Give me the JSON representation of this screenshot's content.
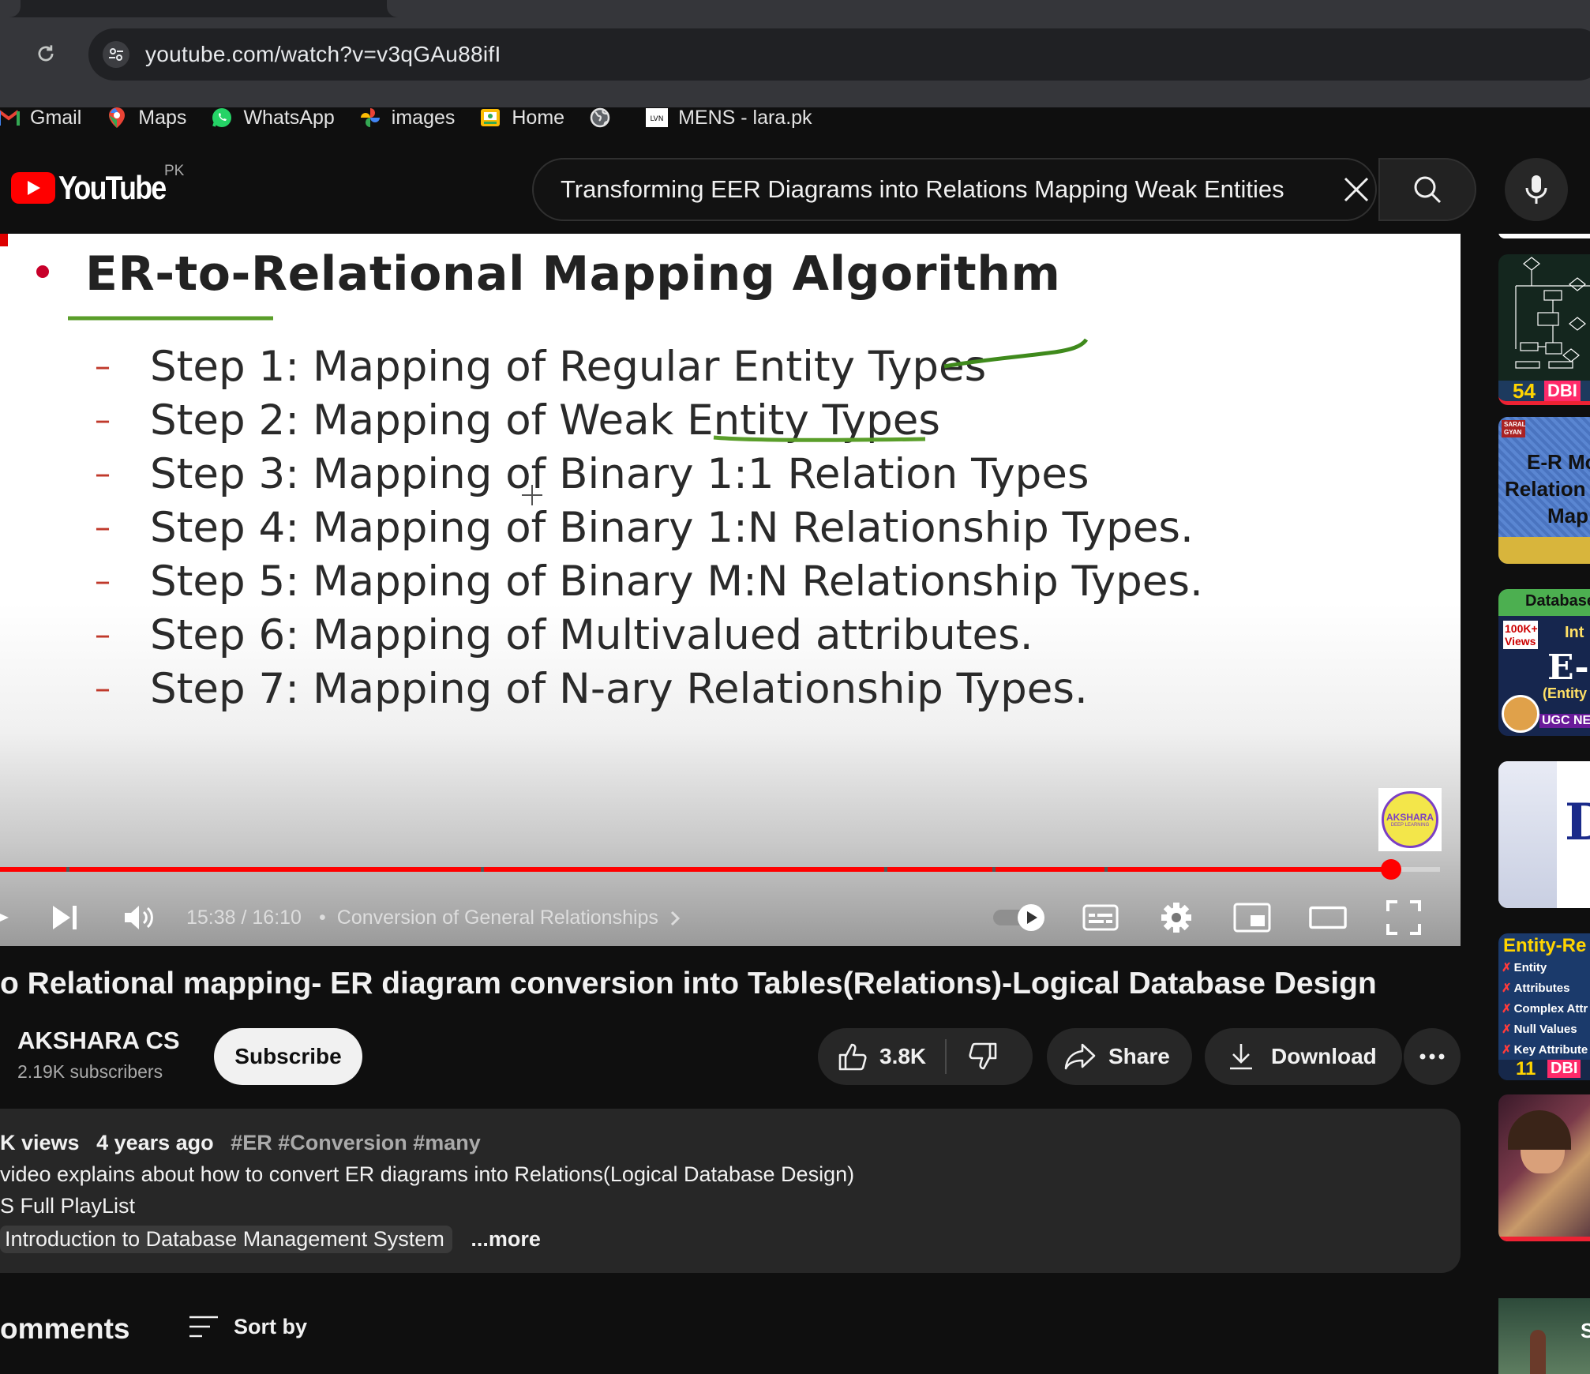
{
  "browser": {
    "url": "youtube.com/watch?v=v3qGAu88ifI",
    "bookmarks": [
      {
        "label": "Gmail",
        "icon": "gmail-icon"
      },
      {
        "label": "Maps",
        "icon": "maps-icon"
      },
      {
        "label": "WhatsApp",
        "icon": "whatsapp-icon"
      },
      {
        "label": "images",
        "icon": "photos-icon"
      },
      {
        "label": "Home",
        "icon": "home-icon"
      },
      {
        "label": "",
        "icon": "globe-icon"
      },
      {
        "label": "MENS - lara.pk",
        "icon": "lara-icon"
      }
    ]
  },
  "header": {
    "logo_text": "YouTube",
    "country_code": "PK",
    "search_query": "Transforming EER Diagrams into Relations Mapping Weak Entities"
  },
  "slide": {
    "title": "ER-to-Relational Mapping Algorithm",
    "steps": [
      "Step 1: Mapping of Regular Entity Types",
      "Step 2: Mapping of Weak Entity Types",
      "Step 3: Mapping of Binary 1:1 Relation Types",
      "Step 4: Mapping of Binary 1:N Relationship Types.",
      "Step 5: Mapping of Binary M:N Relationship Types.",
      "Step 6: Mapping of Multivalued attributes.",
      "Step 7: Mapping of N-ary Relationship Types."
    ],
    "watermark_text": "AKSHARA",
    "watermark_sub": "DEEP LEARNING"
  },
  "player": {
    "time": "15:38 / 16:10",
    "chapter": "Conversion of General Relationships",
    "progress_fraction": 0.966,
    "chapter_marks": [
      0.046,
      0.334,
      0.614,
      0.689,
      0.767
    ]
  },
  "video": {
    "title": "o Relational mapping- ER diagram conversion into Tables(Relations)-Logical Database Design",
    "channel": "AKSHARA CS",
    "subscribers": "2.19K subscribers",
    "subscribe_label": "Subscribe",
    "likes": "3.8K",
    "share_label": "Share",
    "download_label": "Download"
  },
  "description": {
    "views": "K views",
    "age": "4 years ago",
    "tags": "#ER #Conversion #many",
    "line2": "video explains about how to convert ER diagrams into Relations(Logical Database Design)",
    "line3": "S Full PlayList",
    "line4": "Introduction to Database Management System",
    "more_label": "...more"
  },
  "comments": {
    "heading": "omments",
    "sort_label": "Sort by"
  },
  "sidebar": {
    "thumbs": [
      {
        "badge": "54",
        "tag": "DBI"
      },
      {
        "lines": [
          "E-R Mo",
          "Relation",
          "Map"
        ],
        "corner": "SARAL GYAN"
      },
      {
        "top": "Database",
        "badge": "100K+ Views",
        "big": "E-I",
        "sub": "(Entity",
        "bottom": "UGC NE",
        "extra": "Int"
      },
      {
        "big": "D"
      },
      {
        "title": "Entity-Re",
        "items": [
          "Entity",
          "Attributes",
          "Complex Attr",
          "Null Values",
          "Key Attribute"
        ],
        "tag": "DBI",
        "badge": "11"
      },
      {},
      {
        "letter": "S"
      }
    ]
  },
  "colors": {
    "accent_red": "#ff0000",
    "ink_green": "#3f8a1c",
    "background": "#0f0f0f"
  }
}
